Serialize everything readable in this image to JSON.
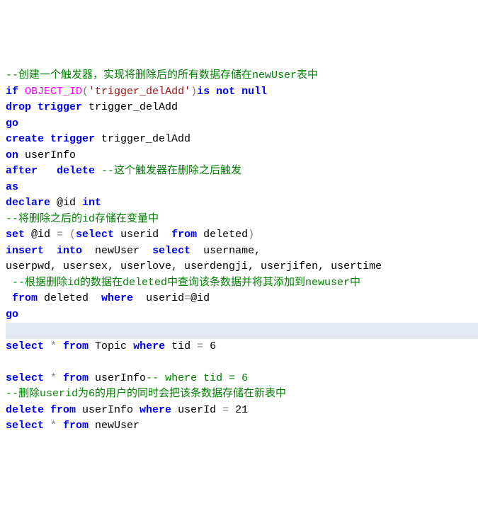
{
  "lines": {
    "c1": "--创建一个触发器，实现将删除后的所有数据存储在newUser表中",
    "l2_if": "if",
    "l2_fn": " OBJECT_ID",
    "l2_op1": "(",
    "l2_str": "'trigger_delAdd'",
    "l2_op2": ")",
    "l2_kw2": "is not null",
    "l3_kw": "drop trigger",
    "l3_id": " trigger_delAdd",
    "l4": "go",
    "l5_kw": "create trigger",
    "l5_id": " trigger_delAdd",
    "l6_kw": "on",
    "l6_id": " userInfo",
    "l7_kw1": "after",
    "l7_sp": "   ",
    "l7_kw2": "delete",
    "l7_cm": " --这个触发器在删除之后触发",
    "l8": "as",
    "l9_kw": "declare",
    "l9_id": " @id ",
    "l9_kw2": "int",
    "c10": "--将删除之后的id存储在变量中",
    "l11_kw1": "set",
    "l11_id1": " @id ",
    "l11_op1": "= (",
    "l11_kw2": "select",
    "l11_id2": " userid  ",
    "l11_kw3": "from",
    "l11_id3": " deleted",
    "l11_op2": ")",
    "l12_kw1": "insert",
    "l12_sp1": "  ",
    "l12_kw2": "into",
    "l12_id1": "  newUser  ",
    "l12_kw3": "select",
    "l12_id2": "  username,",
    "l13": "userpwd, usersex, userlove, userdengji, userjifen, usertime",
    "c14": " --根据删除id的数据在deleted中查询该条数据并将其添加到newuser中",
    "l15_sp": " ",
    "l15_kw1": "from",
    "l15_id1": " deleted  ",
    "l15_kw2": "where",
    "l15_id2": "  userid",
    "l15_op": "=",
    "l15_id3": "@id",
    "l16": "go",
    "blank": " ",
    "l18_kw1": "select",
    "l18_op1": " *",
    "l18_kw2": " from",
    "l18_id1": " Topic ",
    "l18_kw3": "where",
    "l18_id2": " tid ",
    "l18_op2": "= ",
    "l18_num": "6",
    "l20_kw1": "select",
    "l20_op1": " *",
    "l20_kw2": " from",
    "l20_id1": " userInfo",
    "l20_cm": "-- where tid = 6",
    "c21": "--删除userid为6的用户的同时会把该条数据存储在新表中",
    "l22_kw1": "delete",
    "l22_kw2": " from",
    "l22_id1": " userInfo ",
    "l22_kw3": "where",
    "l22_id2": " userId ",
    "l22_op": "= ",
    "l22_num": "21",
    "l23_kw1": "select",
    "l23_op1": " *",
    "l23_kw2": " from",
    "l23_id1": " newUser"
  }
}
